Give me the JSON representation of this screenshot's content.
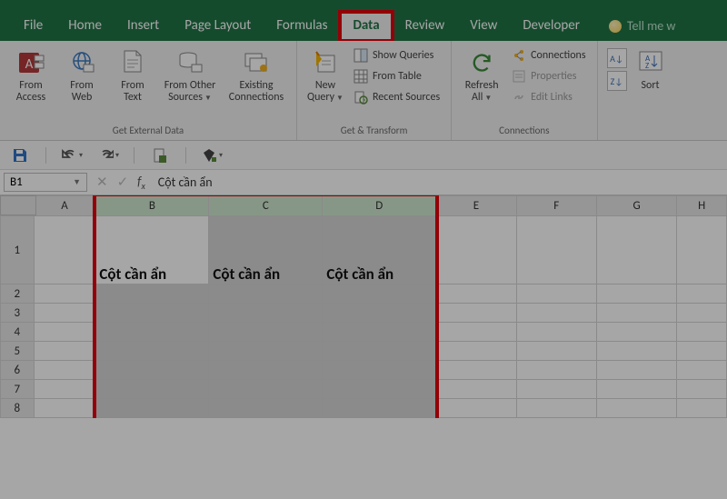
{
  "tabs": {
    "file": "File",
    "home": "Home",
    "insert": "Insert",
    "page_layout": "Page Layout",
    "formulas": "Formulas",
    "data": "Data",
    "review": "Review",
    "view": "View",
    "developer": "Developer",
    "tell_me": "Tell me w"
  },
  "ribbon": {
    "get_external": {
      "from_access": "From\nAccess",
      "from_web": "From\nWeb",
      "from_text": "From\nText",
      "from_other": "From Other\nSources",
      "existing": "Existing\nConnections",
      "label": "Get External Data"
    },
    "get_transform": {
      "new_query": "New\nQuery",
      "show_queries": "Show Queries",
      "from_table": "From Table",
      "recent_sources": "Recent Sources",
      "label": "Get & Transform"
    },
    "connections": {
      "refresh_all": "Refresh\nAll",
      "connections": "Connections",
      "properties": "Properties",
      "edit_links": "Edit Links",
      "label": "Connections"
    },
    "sort": {
      "sort": "Sort",
      "az": "A↓Z",
      "za": "Z↓A"
    }
  },
  "namebox": "B1",
  "formula": "Cột cần ẩn",
  "columns": [
    "A",
    "B",
    "C",
    "D",
    "E",
    "F",
    "G",
    "H"
  ],
  "rows": [
    "1",
    "2",
    "3",
    "4",
    "5",
    "6",
    "7",
    "8"
  ],
  "cells": {
    "B1": "Cột cần ẩn",
    "C1": "Cột cần ẩn",
    "D1": "Cột cần ẩn"
  }
}
